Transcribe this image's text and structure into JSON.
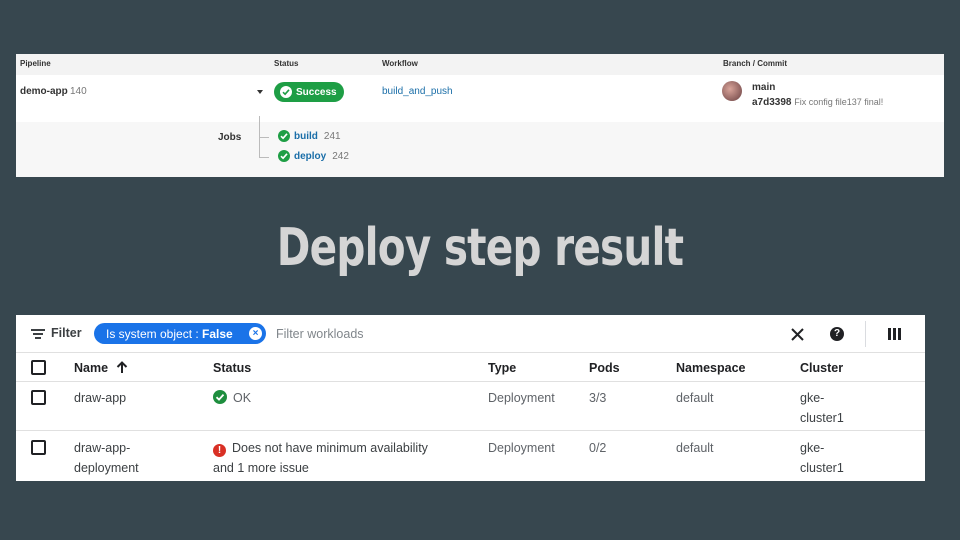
{
  "pipeline_panel": {
    "headers": {
      "pipeline": "Pipeline",
      "status": "Status",
      "workflow": "Workflow",
      "branch_commit": "Branch / Commit"
    },
    "row": {
      "name": "demo-app",
      "number": "140",
      "status": "Success",
      "workflow": "build_and_push",
      "branch": "main",
      "commit_hash": "a7d3398",
      "commit_message": "Fix config file137 final!"
    },
    "jobs_label": "Jobs",
    "jobs": [
      {
        "name": "build",
        "number": "241"
      },
      {
        "name": "deploy",
        "number": "242"
      }
    ],
    "colors": {
      "success": "#1e9e45",
      "link": "#1a6ea8"
    }
  },
  "title": "Deploy step result",
  "workloads": {
    "toolbar": {
      "filter_label": "Filter",
      "chip_key": "Is system object",
      "chip_sep": " : ",
      "chip_value": "False",
      "filter_placeholder": "Filter workloads"
    },
    "columns": [
      "Name",
      "Status",
      "Type",
      "Pods",
      "Namespace",
      "Cluster"
    ],
    "rows": [
      {
        "name_line1": "draw-app",
        "name_line2": "",
        "status_line1": "OK",
        "status_line2": "",
        "status_kind": "ok",
        "type": "Deployment",
        "pods": "3/3",
        "namespace": "default",
        "cluster_line1": "gke-",
        "cluster_line2": "cluster1"
      },
      {
        "name_line1": "draw-app-",
        "name_line2": "deployment",
        "status_line1": "Does not have minimum availability",
        "status_line2": "and 1 more issue",
        "status_kind": "error",
        "type": "Deployment",
        "pods": "0/2",
        "namespace": "default",
        "cluster_line1": "gke-",
        "cluster_line2": "cluster1"
      }
    ],
    "colors": {
      "chip": "#1a73e8",
      "ok": "#1e8e3e",
      "error": "#d93025"
    }
  }
}
